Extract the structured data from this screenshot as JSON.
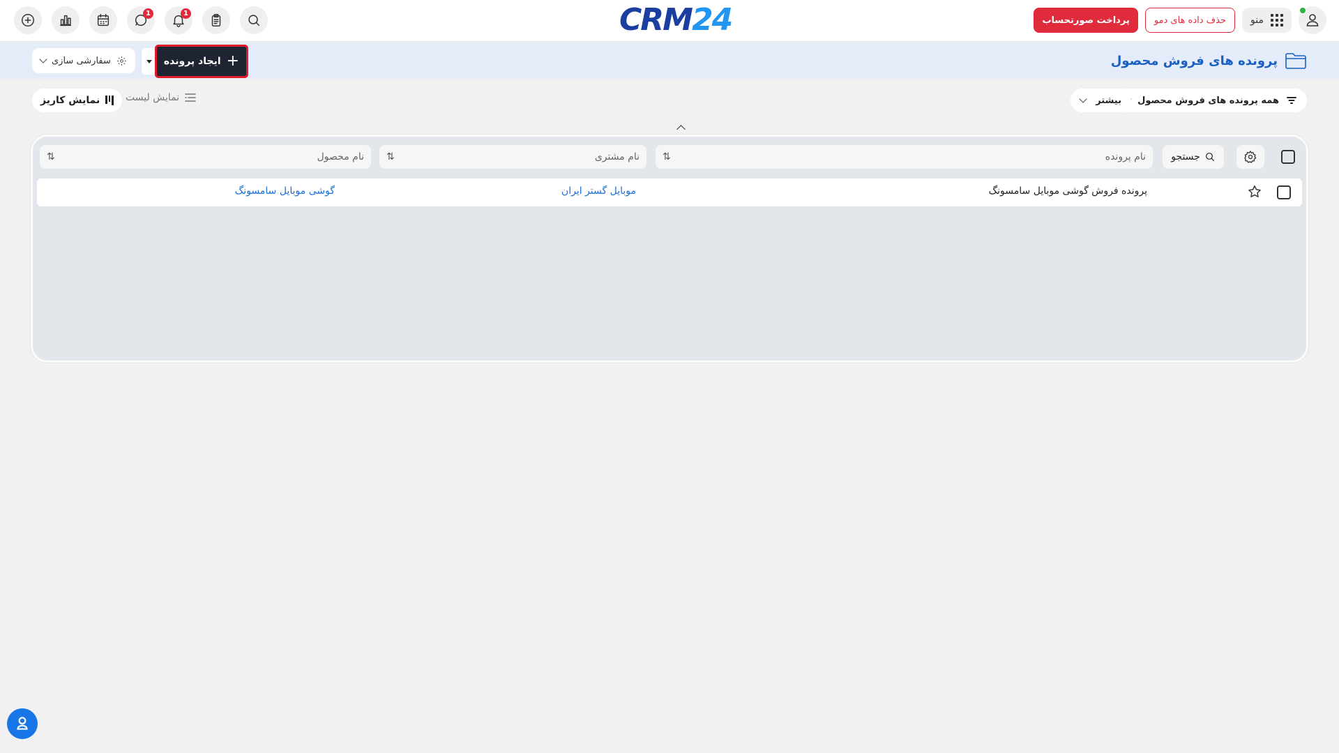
{
  "topbar": {
    "logo": {
      "crm": "CRM",
      "num": "24"
    },
    "menu_label": "منو",
    "delete_demo_label": "حذف داده های دمو",
    "pay_invoice_label": "پرداخت صورتحساب",
    "icons": [
      "plus-circle-icon",
      "chart-icon",
      "calendar-icon",
      "chat-icon",
      "bell-icon",
      "clipboard-icon",
      "search-icon"
    ],
    "badges": {
      "chat": "1",
      "bell": "1"
    }
  },
  "header": {
    "title": "پرونده های فروش محصول",
    "create_label": "ایجاد پرونده",
    "customize_label": "سفارشی سازی"
  },
  "filters": {
    "all_label": "همه پرونده های فروش محصول",
    "more_label": "بیشتر",
    "list_view_label": "نمایش لیست",
    "kanban_view_label": "نمایش کاریز"
  },
  "table": {
    "search_label": "جستجو",
    "columns": [
      {
        "label": "نام پرونده"
      },
      {
        "label": "نام مشتری"
      },
      {
        "label": "نام محصول"
      }
    ],
    "rows": [
      {
        "name": "پرونده فروش گوشی موبایل سامسونگ",
        "customer": "موبایل گستر ایران",
        "product": "گوشی موبایل سامسونگ"
      }
    ]
  },
  "colors": {
    "accent": "#1a5fc4",
    "danger": "#e02b3c",
    "dark_button": "#1f2433",
    "header_band": "#e3ecf8"
  }
}
